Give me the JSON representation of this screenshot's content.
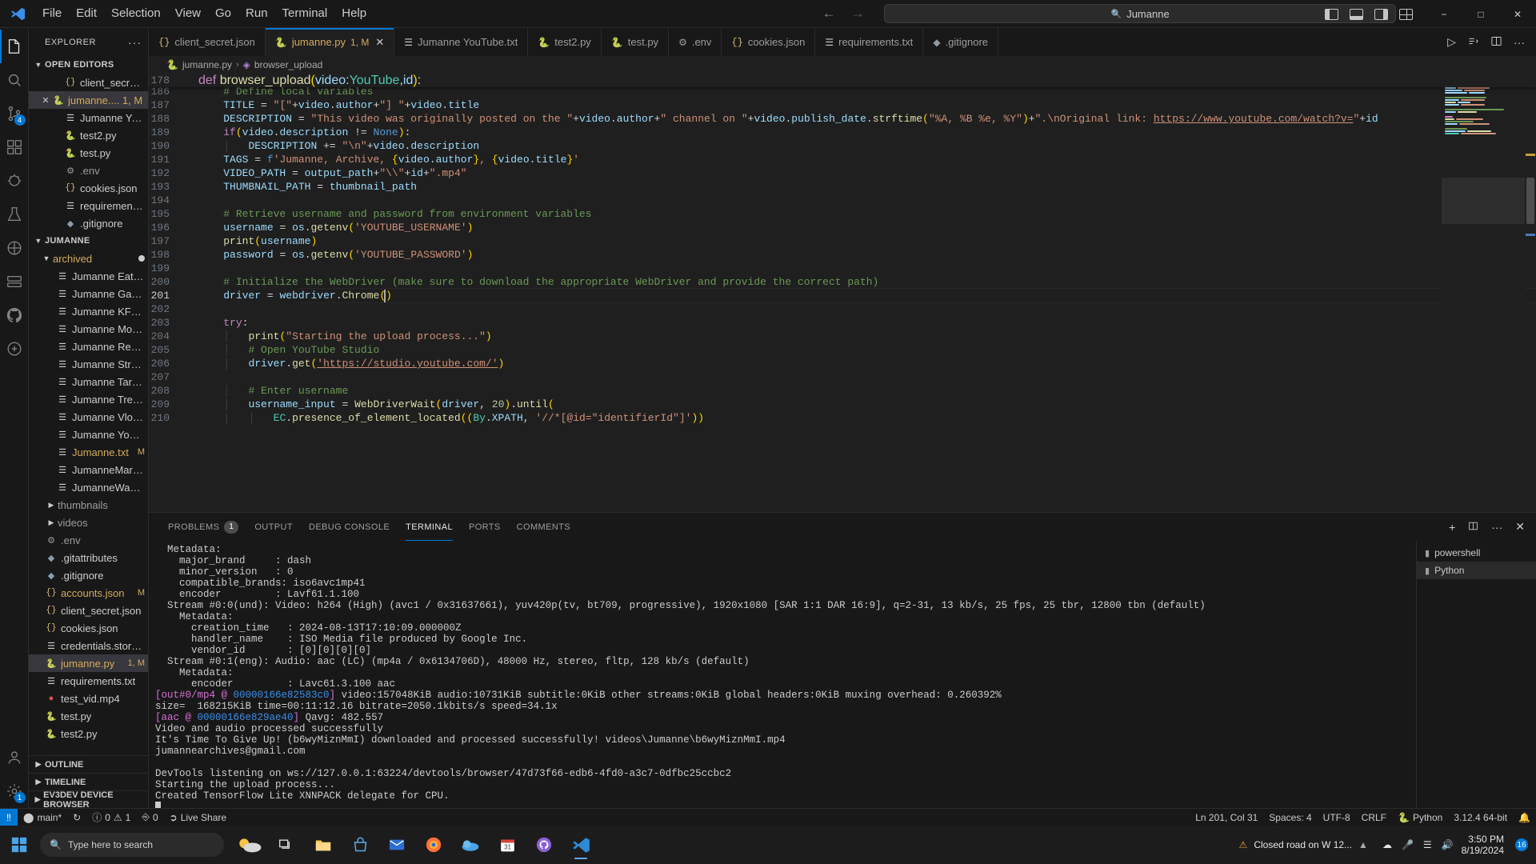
{
  "titlebar": {
    "menus": [
      "File",
      "Edit",
      "Selection",
      "View",
      "Go",
      "Run",
      "Terminal",
      "Help"
    ],
    "back_arrow": "←",
    "forward_arrow": "→",
    "search_value": "Jumanne",
    "search_icon": "search-icon",
    "layout_left_label": "toggle-primary-sidebar",
    "layout_panel_label": "toggle-panel",
    "layout_right_label": "toggle-secondary-sidebar",
    "layout_grid_label": "customize-layout",
    "minimize": "−",
    "maximize": "□",
    "close": "✕"
  },
  "activitybar": {
    "items": [
      {
        "name": "explorer",
        "icon": "files-icon",
        "active": true,
        "badge": ""
      },
      {
        "name": "search",
        "icon": "search-icon",
        "active": false,
        "badge": ""
      },
      {
        "name": "source-control",
        "icon": "source-control-icon",
        "active": false,
        "badge": "4"
      },
      {
        "name": "extensions",
        "icon": "extensions-icon",
        "active": false,
        "badge": ""
      },
      {
        "name": "run-and-debug",
        "icon": "debug-icon",
        "active": false,
        "badge": ""
      },
      {
        "name": "testing",
        "icon": "beaker-icon",
        "active": false,
        "badge": ""
      },
      {
        "name": "docker",
        "icon": "docker-icon",
        "active": false,
        "badge": ""
      },
      {
        "name": "remote-explorer",
        "icon": "remote-icon",
        "active": false,
        "badge": ""
      },
      {
        "name": "github",
        "icon": "github-icon",
        "active": false,
        "badge": ""
      },
      {
        "name": "live-share",
        "icon": "live-share-icon",
        "active": false,
        "badge": ""
      }
    ],
    "bottom": [
      {
        "name": "accounts",
        "icon": "account-icon",
        "badge": ""
      },
      {
        "name": "manage-settings",
        "icon": "gear-icon",
        "badge": "1"
      }
    ]
  },
  "sidebar": {
    "title": "EXPLORER",
    "more_actions": "···",
    "open_editors": {
      "label": "OPEN EDITORS",
      "expanded": true,
      "items": [
        {
          "label": "client_secret.json",
          "icon": "json-icon",
          "state": "",
          "selected": false,
          "close": false
        },
        {
          "label": "jumanne.... 1, M",
          "icon": "python-icon",
          "state": "modified",
          "selected": true,
          "close": true
        },
        {
          "label": "Jumanne YouTu...",
          "icon": "txt-icon",
          "state": "",
          "selected": false,
          "close": false
        },
        {
          "label": "test2.py",
          "icon": "python-icon",
          "state": "",
          "selected": false,
          "close": false
        },
        {
          "label": "test.py",
          "icon": "python-icon",
          "state": "",
          "selected": false,
          "close": false
        },
        {
          "label": ".env",
          "icon": "env-icon",
          "state": "dim",
          "selected": false,
          "close": false
        },
        {
          "label": "cookies.json",
          "icon": "json-icon",
          "state": "",
          "selected": false,
          "close": false
        },
        {
          "label": "requirements.txt",
          "icon": "txt-icon",
          "state": "",
          "selected": false,
          "close": false
        },
        {
          "label": ".gitignore",
          "icon": "git-icon",
          "state": "",
          "selected": false,
          "close": false
        }
      ]
    },
    "workspace": {
      "label": "JUMANNE",
      "expanded": true,
      "folders": [
        {
          "label": "archived",
          "expanded": true,
          "dirty": true
        }
      ],
      "files": [
        {
          "label": "Jumanne Eats.txt",
          "icon": "txt-icon",
          "indent": 3,
          "mark": ""
        },
        {
          "label": "Jumanne Gambling....",
          "icon": "txt-icon",
          "indent": 3,
          "mark": ""
        },
        {
          "label": "Jumanne KFC.txt",
          "icon": "txt-icon",
          "indent": 3,
          "mark": ""
        },
        {
          "label": "Jumanne Monologu...",
          "icon": "txt-icon",
          "indent": 3,
          "mark": ""
        },
        {
          "label": "Jumanne Reactions.t...",
          "icon": "txt-icon",
          "indent": 3,
          "mark": ""
        },
        {
          "label": "Jumanne Struggled....",
          "icon": "txt-icon",
          "indent": 3,
          "mark": ""
        },
        {
          "label": "Jumanne Target.txt",
          "icon": "txt-icon",
          "indent": 3,
          "mark": ""
        },
        {
          "label": "Jumanne Tree.txt",
          "icon": "txt-icon",
          "indent": 3,
          "mark": ""
        },
        {
          "label": "Jumanne Vlogs.txt",
          "icon": "txt-icon",
          "indent": 3,
          "mark": ""
        },
        {
          "label": "Jumanne YouTube.txt",
          "icon": "txt-icon",
          "indent": 3,
          "mark": ""
        },
        {
          "label": "Jumanne.txt",
          "icon": "txt-icon",
          "indent": 3,
          "mark": "M",
          "modified": true
        },
        {
          "label": "JumanneMart.txt",
          "icon": "txt-icon",
          "indent": 3,
          "mark": ""
        },
        {
          "label": "JumanneWay.txt",
          "icon": "txt-icon",
          "indent": 3,
          "mark": ""
        }
      ],
      "subfolders": [
        {
          "label": "thumbnails",
          "expanded": false
        },
        {
          "label": "videos",
          "expanded": false
        }
      ],
      "rootfiles": [
        {
          "label": ".env",
          "icon": "env-icon",
          "mark": "",
          "dim": true
        },
        {
          "label": ".gitattributes",
          "icon": "git-icon",
          "mark": "",
          "dim": false
        },
        {
          "label": ".gitignore",
          "icon": "git-icon",
          "mark": "",
          "dim": false
        },
        {
          "label": "accounts.json",
          "icon": "json-icon",
          "mark": "M",
          "modified": true
        },
        {
          "label": "client_secret.json",
          "icon": "json-icon",
          "mark": "",
          "dim": false
        },
        {
          "label": "cookies.json",
          "icon": "json-icon",
          "mark": "",
          "dim": false
        },
        {
          "label": "credentials.storage",
          "icon": "txt-icon",
          "mark": "",
          "dim": false
        },
        {
          "label": "jumanne.py",
          "icon": "python-icon",
          "mark": "1, M",
          "modified": true,
          "selected": true
        },
        {
          "label": "requirements.txt",
          "icon": "txt-icon",
          "mark": "",
          "dim": false
        },
        {
          "label": "test_vid.mp4",
          "icon": "video-icon",
          "mark": "",
          "dim": false
        },
        {
          "label": "test.py",
          "icon": "python-icon",
          "mark": "",
          "dim": false
        },
        {
          "label": "test2.py",
          "icon": "python-icon",
          "mark": "",
          "dim": false
        }
      ]
    },
    "collapsed_sections": [
      {
        "label": "OUTLINE",
        "gear": false
      },
      {
        "label": "TIMELINE",
        "gear": false
      },
      {
        "label": "EV3DEV DEVICE BROWSER",
        "gear": true
      }
    ]
  },
  "tabs": [
    {
      "label": "client_secret.json",
      "icon": "json-icon",
      "active": false,
      "badge": "",
      "close": false
    },
    {
      "label": "jumanne.py",
      "icon": "python-icon",
      "active": true,
      "badge": "1, M",
      "close": true
    },
    {
      "label": "Jumanne YouTube.txt",
      "icon": "txt-icon",
      "active": false,
      "badge": "",
      "close": false
    },
    {
      "label": "test2.py",
      "icon": "python-icon",
      "active": false,
      "badge": "",
      "close": false
    },
    {
      "label": "test.py",
      "icon": "python-icon",
      "active": false,
      "badge": "",
      "close": false
    },
    {
      "label": ".env",
      "icon": "env-icon",
      "active": false,
      "badge": "",
      "close": false
    },
    {
      "label": "cookies.json",
      "icon": "json-icon",
      "active": false,
      "badge": "",
      "close": false
    },
    {
      "label": "requirements.txt",
      "icon": "txt-icon",
      "active": false,
      "badge": "",
      "close": false
    },
    {
      "label": ".gitignore",
      "icon": "git-icon",
      "active": false,
      "badge": "",
      "close": false
    }
  ],
  "editor_actions": {
    "run_label": "▷",
    "run_dropdown": "⌄",
    "split_label": "split-editor",
    "more_label": "···"
  },
  "breadcrumb": {
    "file": "jumanne.py",
    "separator": "›",
    "symbol": "browser_upload"
  },
  "code": {
    "sticky": {
      "num": "178",
      "text": "def browser_upload(video:YouTube,id):"
    },
    "lines": [
      {
        "num": "186",
        "text": "    # Define local variables"
      },
      {
        "num": "187",
        "text": "    TITLE = \"[\"+video.author+\"] \"+video.title"
      },
      {
        "num": "188",
        "text": "    DESCRIPTION = \"This video was originally posted on the \"+video.author+\" channel on \"+video.publish_date.strftime(\"%A, %B %e, %Y\")+\".\\nOriginal link: https://www.youtube.com/watch?v=\"+id"
      },
      {
        "num": "189",
        "text": "    if(video.description != None):"
      },
      {
        "num": "190",
        "text": "        DESCRIPTION += \"\\n\"+video.description"
      },
      {
        "num": "191",
        "text": "    TAGS = f'Jumanne, Archive, {video.author}, {video.title}'"
      },
      {
        "num": "192",
        "text": "    VIDEO_PATH = output_path+\"\\\\\"+id+\".mp4\""
      },
      {
        "num": "193",
        "text": "    THUMBNAIL_PATH = thumbnail_path"
      },
      {
        "num": "194",
        "text": ""
      },
      {
        "num": "195",
        "text": "    # Retrieve username and password from environment variables"
      },
      {
        "num": "196",
        "text": "    username = os.getenv('YOUTUBE_USERNAME')"
      },
      {
        "num": "197",
        "text": "    print(username)"
      },
      {
        "num": "198",
        "text": "    password = os.getenv('YOUTUBE_PASSWORD')"
      },
      {
        "num": "199",
        "text": ""
      },
      {
        "num": "200",
        "text": "    # Initialize the WebDriver (make sure to download the appropriate WebDriver and provide the correct path)"
      },
      {
        "num": "201",
        "text": "    driver = webdriver.Chrome()",
        "current": true
      },
      {
        "num": "202",
        "text": ""
      },
      {
        "num": "203",
        "text": "    try:"
      },
      {
        "num": "204",
        "text": "        print(\"Starting the upload process...\")"
      },
      {
        "num": "205",
        "text": "        # Open YouTube Studio"
      },
      {
        "num": "206",
        "text": "        driver.get('https://studio.youtube.com/')"
      },
      {
        "num": "207",
        "text": ""
      },
      {
        "num": "208",
        "text": "        # Enter username"
      },
      {
        "num": "209",
        "text": "        username_input = WebDriverWait(driver, 20).until("
      },
      {
        "num": "210",
        "text": "            EC.presence_of_element_located((By.XPATH, '//*[@id=\"identifierId\"]'))"
      }
    ]
  },
  "panel": {
    "tabs": [
      {
        "label": "PROBLEMS",
        "badge": "1",
        "active": false
      },
      {
        "label": "OUTPUT",
        "badge": "",
        "active": false
      },
      {
        "label": "DEBUG CONSOLE",
        "badge": "",
        "active": false
      },
      {
        "label": "TERMINAL",
        "badge": "",
        "active": true
      },
      {
        "label": "PORTS",
        "badge": "",
        "active": false
      },
      {
        "label": "COMMENTS",
        "badge": "",
        "active": false
      }
    ],
    "actions": {
      "new_terminal": "+",
      "split": "split-terminal",
      "more": "···",
      "close": "✕"
    },
    "terminal_list": [
      {
        "label": "powershell",
        "icon": "terminal-icon",
        "active": false
      },
      {
        "label": "Python",
        "icon": "terminal-icon",
        "active": true
      }
    ],
    "terminal_output": [
      {
        "t": "  Metadata:"
      },
      {
        "t": "    major_brand     : dash"
      },
      {
        "t": "    minor_version   : 0"
      },
      {
        "t": "    compatible_brands: iso6avc1mp41"
      },
      {
        "t": "    encoder         : Lavf61.1.100"
      },
      {
        "t": "  Stream #0:0(und): Video: h264 (High) (avc1 / 0x31637661), yuv420p(tv, bt709, progressive), 1920x1080 [SAR 1:1 DAR 16:9], q=2-31, 13 kb/s, 25 fps, 25 tbr, 12800 tbn (default)"
      },
      {
        "t": "    Metadata:"
      },
      {
        "t": "      creation_time   : 2024-08-13T17:10:09.000000Z"
      },
      {
        "t": "      handler_name    : ISO Media file produced by Google Inc."
      },
      {
        "t": "      vendor_id       : [0][0][0][0]"
      },
      {
        "t": "  Stream #0:1(eng): Audio: aac (LC) (mp4a / 0x6134706D), 48000 Hz, stereo, fltp, 128 kb/s (default)"
      },
      {
        "t": "    Metadata:"
      },
      {
        "t": "      encoder         : Lavc61.3.100 aac"
      },
      {
        "t": "[out#0/mp4 @ 00000166e82583c0] video:157048KiB audio:10731KiB subtitle:0KiB other streams:0KiB global headers:0KiB muxing overhead: 0.260392%",
        "pink_prefix": "[out#0/mp4 @ ",
        "blue_mid": "00000166e82583c0",
        "pink_suffix": "]",
        "rest": " video:157048KiB audio:10731KiB subtitle:0KiB other streams:0KiB global headers:0KiB muxing overhead: 0.260392%"
      },
      {
        "t": "size=  168215KiB time=00:11:12.16 bitrate=2050.1kbits/s speed=34.1x"
      },
      {
        "t": "[aac @ 00000166e829ae40] Qavg: 482.557",
        "pink_prefix": "[aac @ ",
        "blue_mid": "00000166e829ae40",
        "pink_suffix": "]",
        "rest": " Qavg: 482.557"
      },
      {
        "t": "Video and audio processed successfully"
      },
      {
        "t": "It's Time To Give Up! (b6wyMiznMmI) downloaded and processed successfully! videos\\Jumanne\\b6wyMiznMmI.mp4"
      },
      {
        "t": "jumannearchives@gmail.com"
      },
      {
        "t": ""
      },
      {
        "t": "DevTools listening on ws://127.0.0.1:63224/devtools/browser/47d73f66-edb6-4fd0-a3c7-0dfbc25ccbc2"
      },
      {
        "t": "Starting the upload process..."
      },
      {
        "t": "Created TensorFlow Lite XNNPACK delegate for CPU."
      }
    ]
  },
  "statusbar": {
    "remote_label": "main*",
    "sync_icon": "sync-icon",
    "errors": "0",
    "warnings": "1",
    "ports": "0",
    "liveshare": "Live Share",
    "cursor": "Ln 201, Col 31",
    "spaces": "Spaces: 4",
    "encoding": "UTF-8",
    "eol": "CRLF",
    "language": "Python",
    "interpreter": "3.12.4 64-bit",
    "bell": "notifications-icon"
  },
  "taskbar": {
    "search_placeholder": "Type here to search",
    "news_text": "Closed road on W 12...",
    "clock_time": "3:50 PM",
    "clock_date": "8/19/2024",
    "notification_count": "16",
    "apps": [
      {
        "name": "task-view",
        "icon": "task-view-icon"
      },
      {
        "name": "file-explorer",
        "icon": "folder-icon"
      },
      {
        "name": "store",
        "icon": "store-icon"
      },
      {
        "name": "mail",
        "icon": "mail-icon"
      },
      {
        "name": "firefox",
        "icon": "firefox-icon"
      },
      {
        "name": "onedrive-app",
        "icon": "cloud-icon"
      },
      {
        "name": "calendar",
        "icon": "calendar-icon"
      },
      {
        "name": "github-desktop",
        "icon": "github-icon"
      },
      {
        "name": "vscode",
        "icon": "vscode-icon",
        "active": true
      }
    ]
  }
}
